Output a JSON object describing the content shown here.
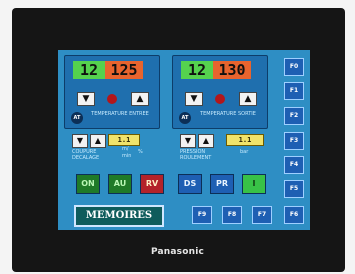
{
  "brand": "Panasonic",
  "left_panel": {
    "temp_setpoint": "12",
    "temp_actual": "125",
    "at_label": "AT",
    "caption": "TEMPERATURE ENTREE"
  },
  "right_panel": {
    "temp_setpoint": "12",
    "temp_actual": "130",
    "at_label": "AT",
    "caption": "TEMPERATURE SORTIE"
  },
  "mid_left": {
    "value_display": "1.1",
    "caption": "COUPURE DECALAGE",
    "unit_top": "m/",
    "unit_bottom": "min",
    "unit_suffix": "%"
  },
  "mid_right": {
    "value_display": "1.1",
    "caption": "PRESSION ROULEMENT",
    "unit": "bar"
  },
  "buttons": {
    "on": "ON",
    "au": "AU",
    "rv": "RV",
    "ds": "DS",
    "pr": "PR",
    "i": "I"
  },
  "memoires": "MEMOIRES",
  "fkeys_right": [
    "F0",
    "F1",
    "F2",
    "F3",
    "F4",
    "F5",
    "F6"
  ],
  "fkeys_bottom": [
    "F9",
    "F8",
    "F7"
  ],
  "colors": {
    "screen_bg": "#2e8ec4",
    "temp_setpoint_bg": "#55d24e",
    "temp_actual_bg": "#e8642e",
    "key_blue": "#1e5fb3",
    "on_green": "#1f7a28",
    "rv_red": "#b3232a",
    "i_green": "#38c247"
  },
  "icons": {
    "up": "up-arrow-icon",
    "down": "down-arrow-icon",
    "indicator": "indicator-lamp-icon"
  }
}
